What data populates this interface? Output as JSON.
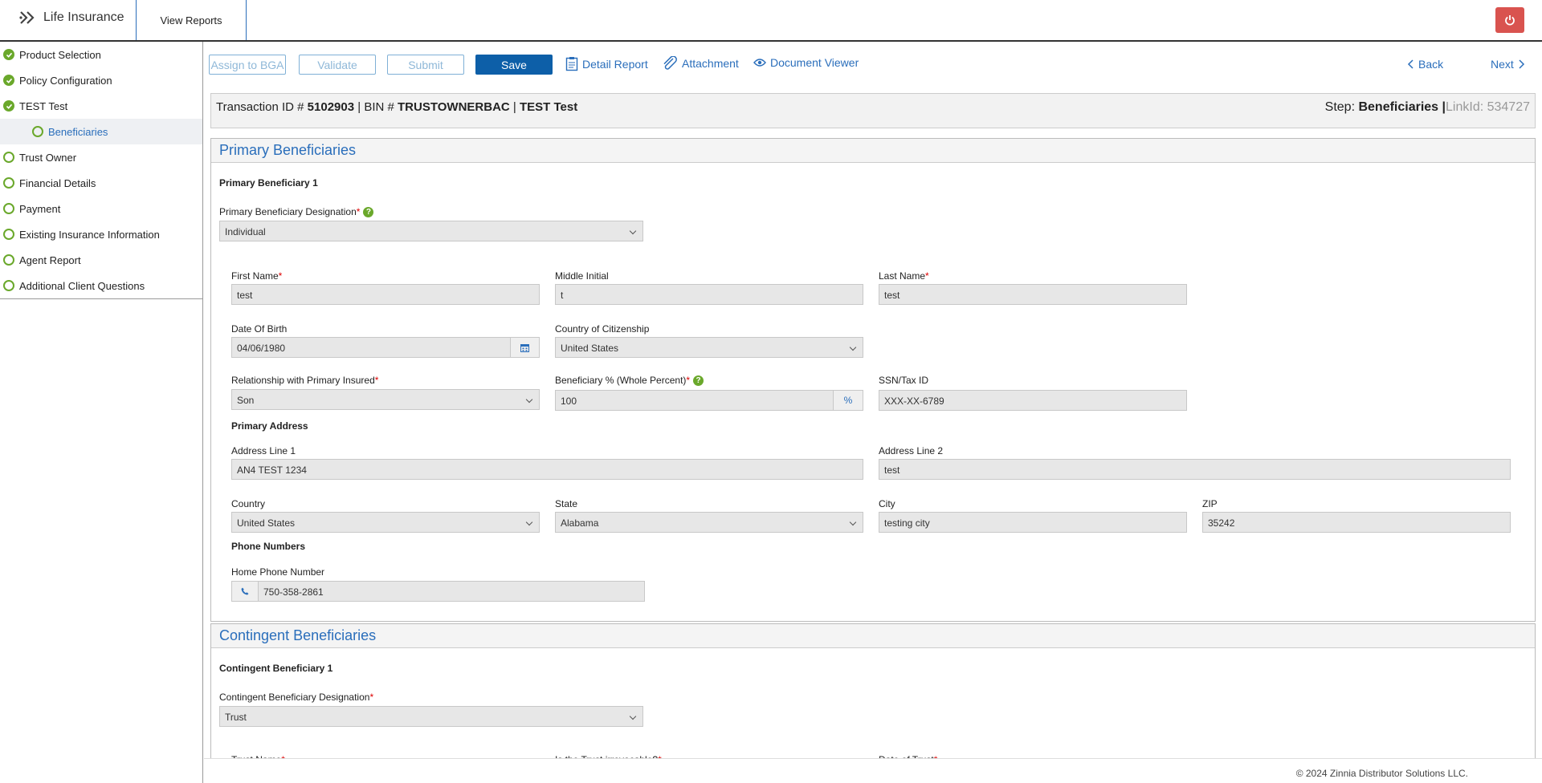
{
  "header": {
    "app_title": "Life Insurance",
    "view_reports": "View Reports"
  },
  "sidebar": {
    "items": [
      {
        "label": "Product Selection",
        "status": "complete"
      },
      {
        "label": "Policy Configuration",
        "status": "complete"
      },
      {
        "label": "TEST Test",
        "status": "complete"
      },
      {
        "label": "Beneficiaries",
        "status": "current"
      },
      {
        "label": "Trust Owner",
        "status": "pending"
      },
      {
        "label": "Financial Details",
        "status": "pending"
      },
      {
        "label": "Payment",
        "status": "pending"
      },
      {
        "label": "Existing Insurance Information",
        "status": "pending"
      },
      {
        "label": "Agent Report",
        "status": "pending"
      },
      {
        "label": "Additional Client Questions",
        "status": "pending"
      }
    ]
  },
  "toolbar": {
    "assign": "Assign to BGA",
    "validate": "Validate",
    "submit": "Submit",
    "save": "Save",
    "detail_report": "Detail Report",
    "attachment": "Attachment",
    "document_viewer": "Document Viewer",
    "back": "Back",
    "next": "Next"
  },
  "transaction": {
    "txn_label": "Transaction ID #",
    "txn_id": "5102903",
    "bin_label": "| BIN #",
    "bin": "TRUSTOWNERBAC",
    "sep": "|",
    "name": "TEST Test",
    "step_label": "Step:",
    "step": "Beneficiaries",
    "link_sep": "|",
    "link_label": "LinkId: 534727"
  },
  "primary": {
    "section_title": "Primary Beneficiaries",
    "sub_title": "Primary Beneficiary 1",
    "designation_label": "Primary Beneficiary Designation",
    "designation": "Individual",
    "first_name_label": "First Name",
    "first_name": "test",
    "middle_initial_label": "Middle Initial",
    "middle_initial": "t",
    "last_name_label": "Last Name",
    "last_name": "test",
    "dob_label": "Date Of Birth",
    "dob": "04/06/1980",
    "citizenship_label": "Country of Citizenship",
    "citizenship": "United States",
    "relationship_label": "Relationship with Primary Insured",
    "relationship": "Son",
    "percent_label": "Beneficiary % (Whole Percent)",
    "percent": "100",
    "percent_sign": "%",
    "ssn_label": "SSN/Tax ID",
    "ssn": "XXX-XX-6789",
    "address_title": "Primary Address",
    "addr1_label": "Address Line 1",
    "addr1": "AN4 TEST 1234",
    "addr2_label": "Address Line 2",
    "addr2": "test",
    "country_label": "Country",
    "country": "United States",
    "state_label": "State",
    "state": "Alabama",
    "city_label": "City",
    "city": "testing city",
    "zip_label": "ZIP",
    "zip": "35242",
    "phone_title": "Phone Numbers",
    "home_phone_label": "Home Phone Number",
    "home_phone": "750-358-2861"
  },
  "contingent": {
    "section_title": "Contingent Beneficiaries",
    "sub_title": "Contingent Beneficiary 1",
    "designation_label": "Contingent Beneficiary Designation",
    "designation": "Trust",
    "trust_name_label": "Trust Name",
    "irrevocable_label": "Is the Trust irrevocable?",
    "date_of_trust_label": "Date of Trust"
  },
  "footer": {
    "copyright": "© 2024 Zinnia Distributor Solutions LLC."
  },
  "colors": {
    "accent": "#2a6ebb",
    "save_button": "#0d5fa8",
    "complete_green": "#6aa82b",
    "power_red": "#d9534f"
  }
}
